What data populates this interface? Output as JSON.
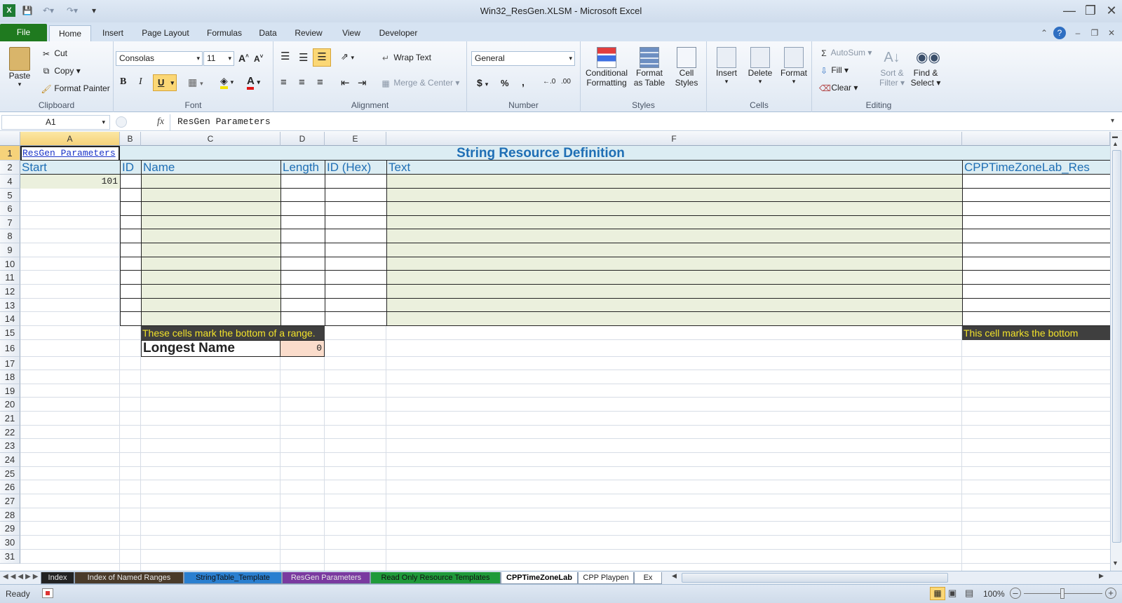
{
  "window": {
    "title": "Win32_ResGen.XLSM  -  Microsoft Excel"
  },
  "ribbon_tabs": [
    "File",
    "Home",
    "Insert",
    "Page Layout",
    "Formulas",
    "Data",
    "Review",
    "View",
    "Developer"
  ],
  "clipboard": {
    "paste": "Paste",
    "cut": "Cut",
    "copy": "Copy",
    "format_painter": "Format Painter",
    "label": "Clipboard"
  },
  "font": {
    "family": "Consolas",
    "size": "11",
    "label": "Font"
  },
  "alignment": {
    "wrap": "Wrap Text",
    "merge": "Merge & Center",
    "label": "Alignment"
  },
  "number": {
    "format": "General",
    "label": "Number"
  },
  "styles": {
    "conditional": [
      "Conditional",
      "Formatting"
    ],
    "format_table": [
      "Format",
      "as Table"
    ],
    "cell_styles": [
      "Cell",
      "Styles"
    ],
    "label": "Styles"
  },
  "cells": {
    "insert": "Insert",
    "delete": "Delete",
    "format": "Format",
    "label": "Cells"
  },
  "editing": {
    "autosum": "AutoSum",
    "fill": "Fill",
    "clear": "Clear",
    "sort": [
      "Sort &",
      "Filter"
    ],
    "find": [
      "Find &",
      "Select"
    ],
    "label": "Editing"
  },
  "formula_bar": {
    "name_box": "A1",
    "fx": "fx",
    "content": "ResGen Parameters"
  },
  "columns": [
    "A",
    "B",
    "C",
    "D",
    "E",
    "F"
  ],
  "rows": [
    "1",
    "2",
    "4",
    "5",
    "6",
    "7",
    "8",
    "9",
    "10",
    "11",
    "12",
    "13",
    "14",
    "15",
    "16",
    "17",
    "18",
    "19",
    "20",
    "21",
    "22",
    "23",
    "24",
    "25",
    "26",
    "27",
    "28",
    "29",
    "30",
    "31"
  ],
  "sheet": {
    "a1": "ResGen Parameters",
    "title": "String Resource Definition",
    "start": "Start",
    "hdr_id": "ID",
    "hdr_name": "Name",
    "hdr_length": "Length",
    "hdr_idhex": "ID (Hex)",
    "hdr_text": "Text",
    "hdr_right": "CPPTimeZoneLab_Res",
    "start_value": "101",
    "bottom_note": "These cells mark the bottom of a range.",
    "bottom_note_right": "This cell marks the bottom",
    "longest_name": "Longest Name",
    "longest_value": "0"
  },
  "sheet_tabs": [
    {
      "label": "Index",
      "color": "#222222"
    },
    {
      "label": "Index of Named Ranges",
      "color": "#4a3b2a"
    },
    {
      "label": "StringTable_Template",
      "color": "#2a7fd0"
    },
    {
      "label": "ResGen Parameters",
      "color": "#7a3aa0"
    },
    {
      "label": "Read Only Resource Templates",
      "color": "#1f9a3a"
    },
    {
      "label": "CPPTimeZoneLab",
      "color": "#ffffff"
    },
    {
      "label": "CPP Playpen",
      "color": "#ffffff"
    },
    {
      "label": "Ex",
      "color": "#ffffff"
    }
  ],
  "status": {
    "ready": "Ready",
    "zoom": "100%"
  }
}
